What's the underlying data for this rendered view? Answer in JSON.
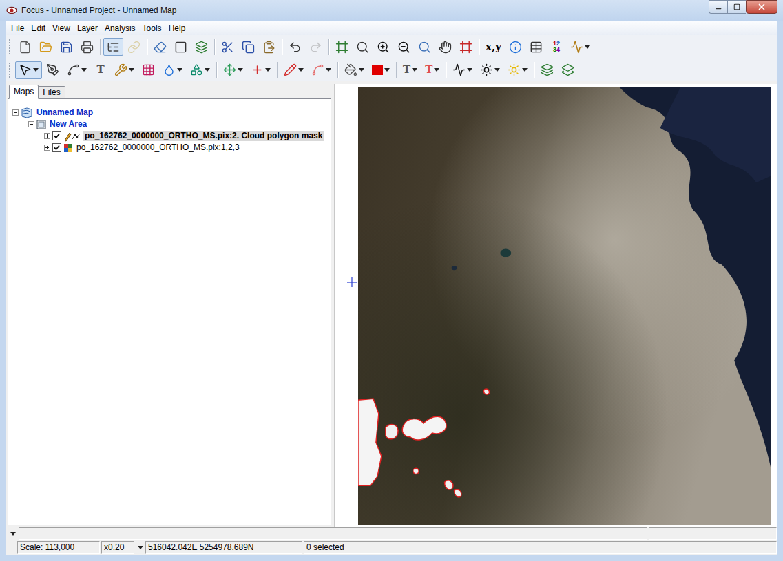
{
  "window": {
    "title": "Focus - Unnamed Project - Unnamed Map"
  },
  "menu": [
    {
      "label": "File"
    },
    {
      "label": "Edit"
    },
    {
      "label": "View"
    },
    {
      "label": "Layer"
    },
    {
      "label": "Analysis"
    },
    {
      "label": "Tools"
    },
    {
      "label": "Help"
    }
  ],
  "toolbars": {
    "main": [
      {
        "kind": "new",
        "pressed": false,
        "disabled": false,
        "dropdown": false
      },
      {
        "kind": "open",
        "pressed": false,
        "disabled": false,
        "dropdown": false
      },
      {
        "kind": "save",
        "pressed": false,
        "disabled": false,
        "dropdown": false
      },
      {
        "kind": "print",
        "pressed": false,
        "disabled": false,
        "dropdown": false
      },
      {
        "kind": "separator"
      },
      {
        "kind": "layer-manager",
        "pressed": true,
        "disabled": false,
        "dropdown": false
      },
      {
        "kind": "link",
        "pressed": false,
        "disabled": true,
        "dropdown": false
      },
      {
        "kind": "separator"
      },
      {
        "kind": "eraser",
        "pressed": false,
        "disabled": false,
        "dropdown": false
      },
      {
        "kind": "window",
        "pressed": false,
        "disabled": false,
        "dropdown": false
      },
      {
        "kind": "layers",
        "pressed": false,
        "disabled": false,
        "dropdown": false
      },
      {
        "kind": "separator"
      },
      {
        "kind": "cut",
        "pressed": false,
        "disabled": false,
        "dropdown": false
      },
      {
        "kind": "copy",
        "pressed": false,
        "disabled": false,
        "dropdown": false
      },
      {
        "kind": "paste",
        "pressed": false,
        "disabled": false,
        "dropdown": false
      },
      {
        "kind": "separator"
      },
      {
        "kind": "undo",
        "pressed": false,
        "disabled": false,
        "dropdown": false
      },
      {
        "kind": "redo",
        "pressed": false,
        "disabled": true,
        "dropdown": false
      },
      {
        "kind": "separator"
      },
      {
        "kind": "zoom-extent",
        "pressed": false,
        "disabled": false,
        "dropdown": false
      },
      {
        "kind": "zoom-box",
        "pressed": false,
        "disabled": false,
        "dropdown": false
      },
      {
        "kind": "zoom-in",
        "pressed": false,
        "disabled": false,
        "dropdown": false
      },
      {
        "kind": "zoom-out",
        "pressed": false,
        "disabled": false,
        "dropdown": false
      },
      {
        "kind": "zoom-layer",
        "pressed": false,
        "disabled": false,
        "dropdown": false
      },
      {
        "kind": "pan",
        "pressed": false,
        "disabled": false,
        "dropdown": false
      },
      {
        "kind": "zoom-window",
        "pressed": false,
        "disabled": false,
        "dropdown": false
      },
      {
        "kind": "separator"
      },
      {
        "kind": "label",
        "label": "x,y",
        "color": "#000000",
        "pressed": false,
        "disabled": false,
        "dropdown": false
      },
      {
        "kind": "info",
        "pressed": false,
        "disabled": false,
        "dropdown": false
      },
      {
        "kind": "table",
        "pressed": false,
        "disabled": false,
        "dropdown": false
      },
      {
        "kind": "digits",
        "digits": [
          {
            "text": "1",
            "color": "#c00000"
          },
          {
            "text": "2",
            "color": "#0050c0"
          },
          {
            "text": "3",
            "color": "#008000"
          },
          {
            "text": "4",
            "color": "#7a00a0"
          }
        ],
        "pressed": false,
        "disabled": false,
        "dropdown": false
      },
      {
        "kind": "chart",
        "pressed": false,
        "disabled": false,
        "dropdown": true
      }
    ],
    "drawing": [
      {
        "kind": "select",
        "pressed": true,
        "disabled": false,
        "dropdown": true
      },
      {
        "kind": "edit-vertex",
        "pressed": false,
        "disabled": false,
        "dropdown": false
      },
      {
        "kind": "polyline",
        "pressed": false,
        "disabled": false,
        "dropdown": true
      },
      {
        "kind": "label",
        "label": "T",
        "color": "#555555",
        "pressed": false,
        "disabled": false,
        "dropdown": false
      },
      {
        "kind": "tools",
        "pressed": false,
        "disabled": false,
        "dropdown": true
      },
      {
        "kind": "grid",
        "pressed": false,
        "disabled": false,
        "dropdown": false
      },
      {
        "kind": "shape",
        "pressed": false,
        "disabled": false,
        "dropdown": true
      },
      {
        "kind": "fill-region",
        "pressed": false,
        "disabled": false,
        "dropdown": true
      },
      {
        "kind": "separator"
      },
      {
        "kind": "move",
        "pressed": false,
        "disabled": false,
        "dropdown": true
      },
      {
        "kind": "cross",
        "pressed": false,
        "disabled": false,
        "dropdown": true
      },
      {
        "kind": "separator"
      },
      {
        "kind": "pencil",
        "pressed": false,
        "disabled": false,
        "dropdown": true
      },
      {
        "kind": "line",
        "pressed": false,
        "disabled": false,
        "dropdown": true
      },
      {
        "kind": "separator"
      },
      {
        "kind": "bucket",
        "pressed": false,
        "disabled": false,
        "dropdown": true
      },
      {
        "kind": "swatch",
        "color": "#e00000",
        "pressed": false,
        "disabled": false,
        "dropdown": true
      },
      {
        "kind": "separator"
      },
      {
        "kind": "label",
        "label": "T",
        "color": "#555555",
        "pressed": false,
        "disabled": false,
        "dropdown": true
      },
      {
        "kind": "label",
        "label": "T",
        "color": "#e05050",
        "pressed": false,
        "disabled": false,
        "dropdown": true
      },
      {
        "kind": "separator"
      },
      {
        "kind": "histogram",
        "pressed": false,
        "disabled": false,
        "dropdown": true
      },
      {
        "kind": "enhance",
        "pressed": false,
        "disabled": false,
        "dropdown": true
      },
      {
        "kind": "sun",
        "pressed": false,
        "disabled": false,
        "dropdown": true
      },
      {
        "kind": "separator"
      },
      {
        "kind": "layers-a",
        "pressed": false,
        "disabled": false,
        "dropdown": false
      },
      {
        "kind": "layers-b",
        "pressed": false,
        "disabled": false,
        "dropdown": false
      }
    ]
  },
  "tabs": [
    {
      "label": "Maps",
      "selected": true
    },
    {
      "label": "Files",
      "selected": false
    }
  ],
  "tree": [
    {
      "label": "Unnamed Map",
      "kind": "map",
      "level": 0,
      "expanded": true,
      "checkable": false,
      "checked": false,
      "selected": false
    },
    {
      "label": "New Area",
      "kind": "area",
      "level": 1,
      "expanded": true,
      "checkable": false,
      "checked": false,
      "selected": false
    },
    {
      "label": "po_162762_0000000_ORTHO_MS.pix:2. Cloud polygon mask",
      "kind": "vector",
      "level": 2,
      "expanded": false,
      "checkable": true,
      "checked": true,
      "selected": true
    },
    {
      "label": "po_162762_0000000_ORTHO_MS.pix:1,2,3",
      "kind": "raster",
      "level": 2,
      "expanded": false,
      "checkable": true,
      "checked": true,
      "selected": false
    }
  ],
  "status_bar": {
    "message": "",
    "scale": "Scale: 113,000",
    "zoom": "x0.20",
    "coordinates": "516042.042E 5254978.689N",
    "selection": "0 selected"
  }
}
